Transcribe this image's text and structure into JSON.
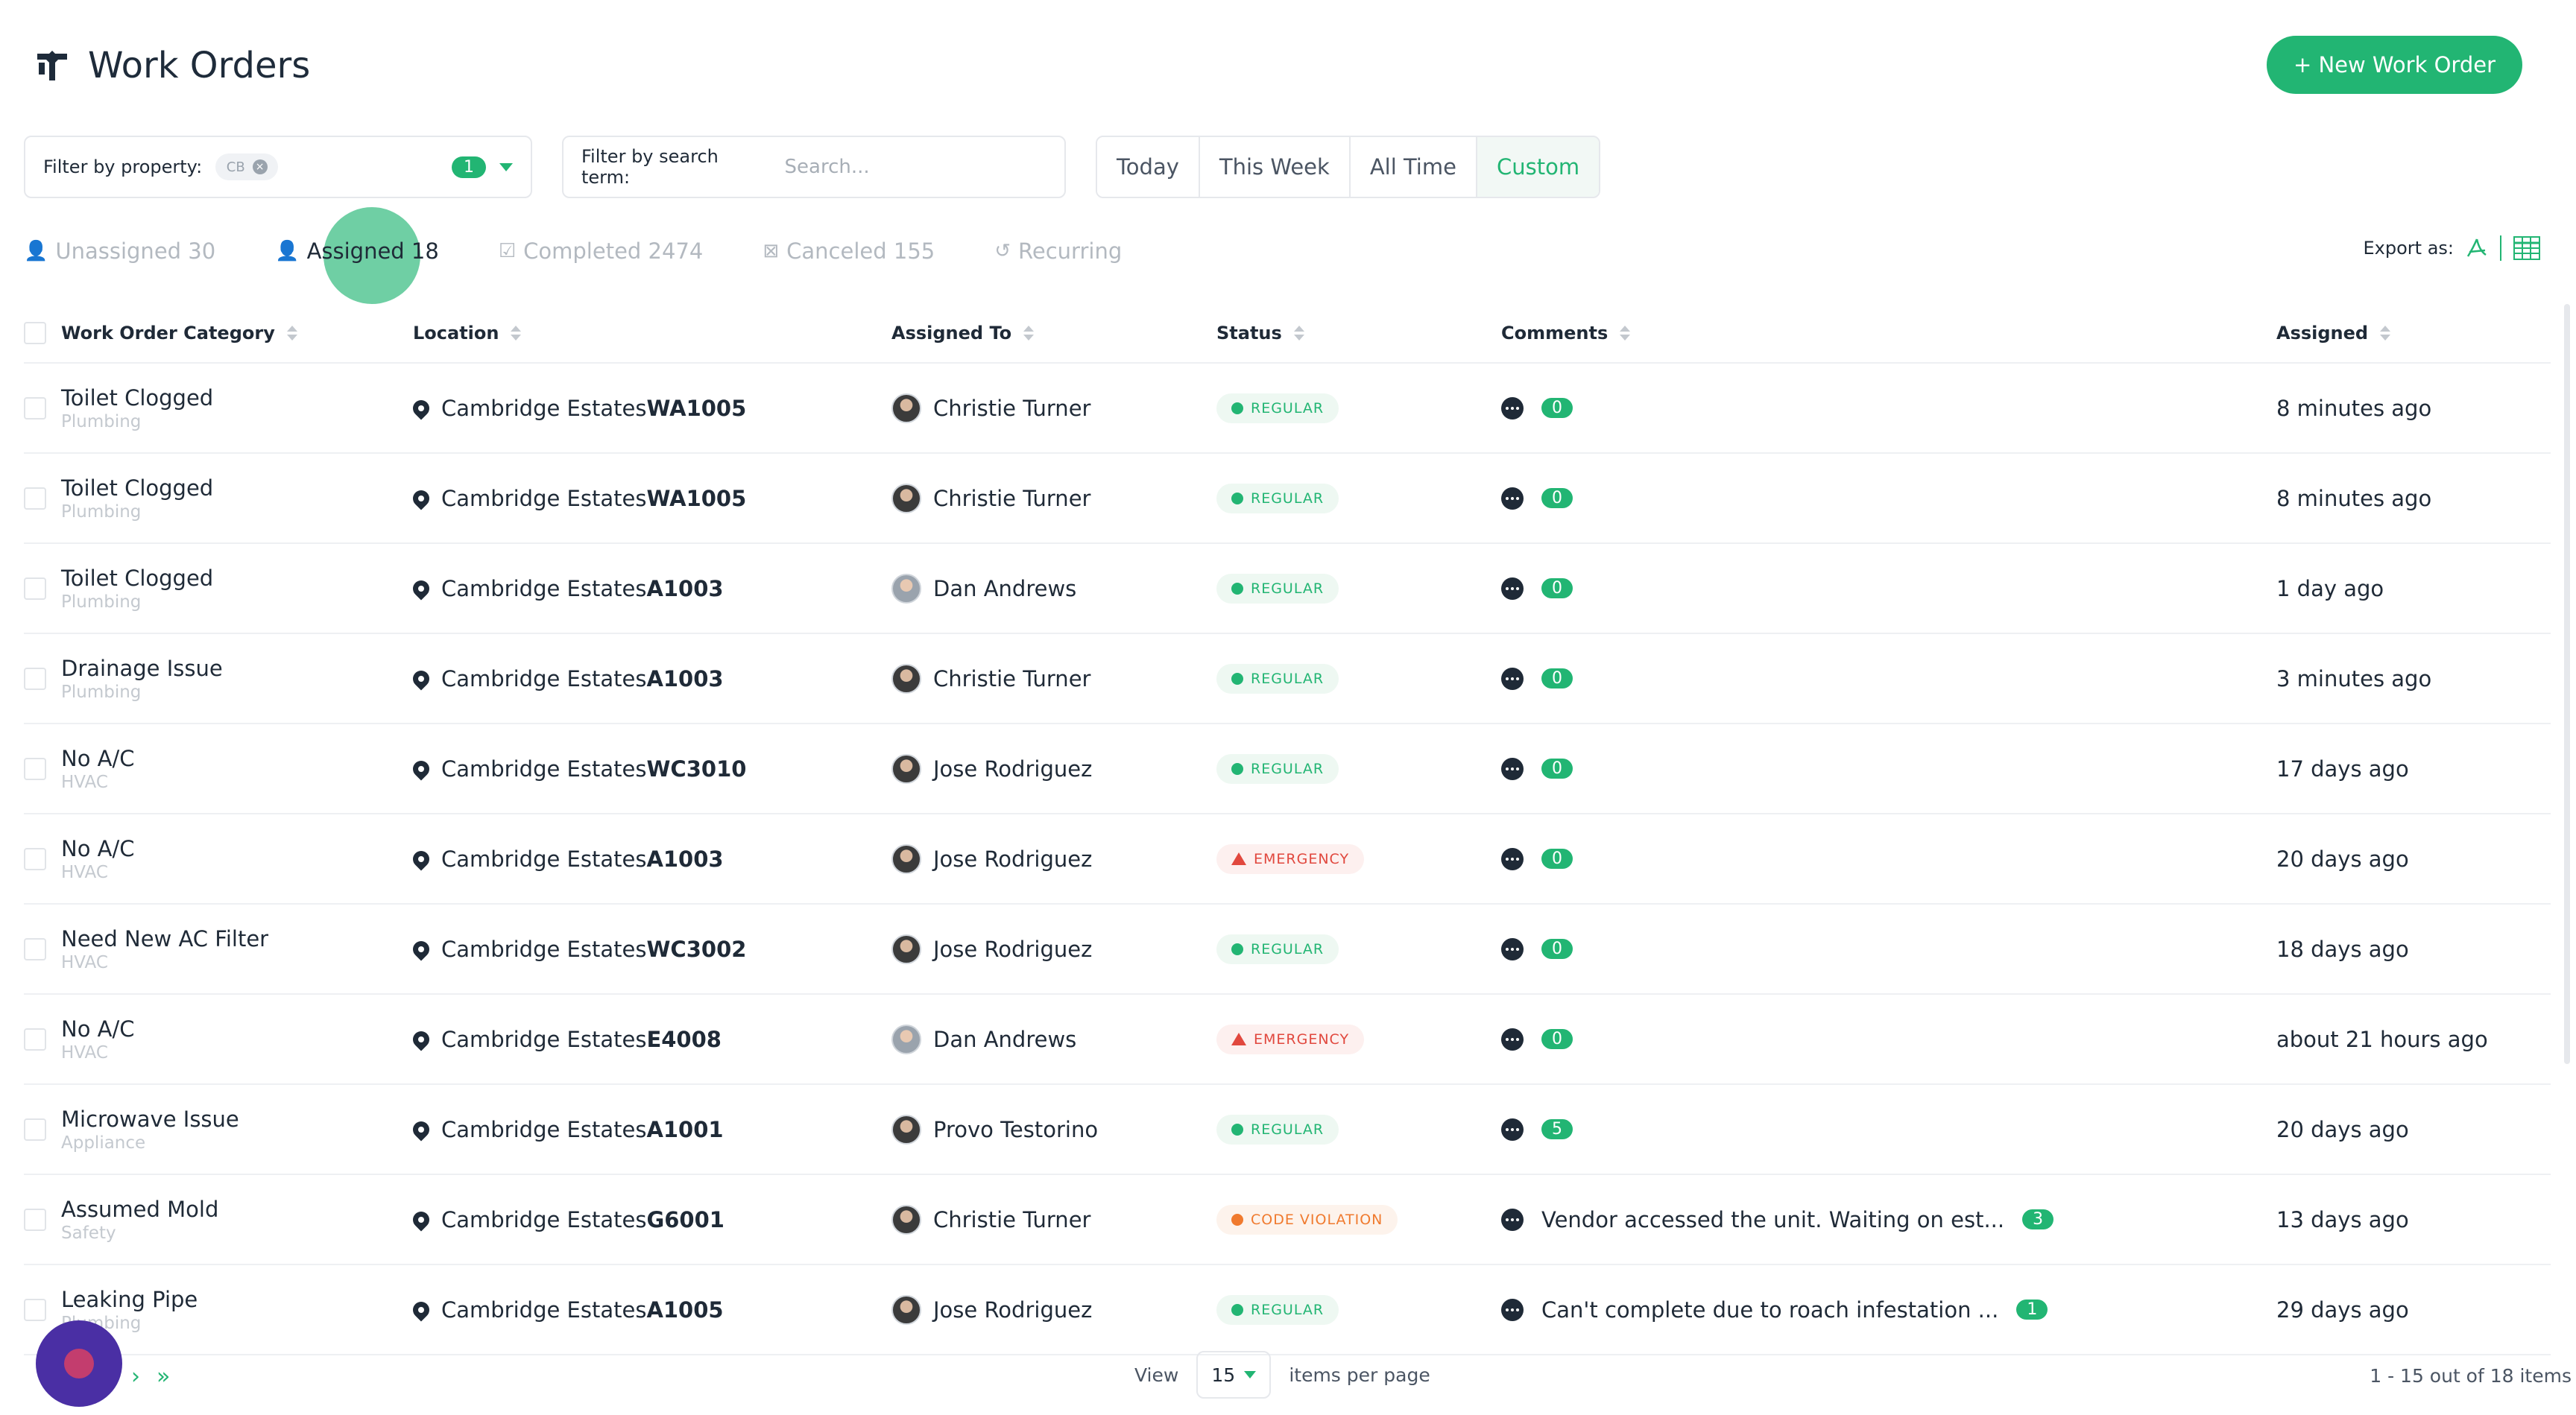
{
  "header": {
    "title": "Work Orders",
    "new_button": "+ New Work Order"
  },
  "filters": {
    "property_label": "Filter by property:",
    "property_chip": "CB",
    "property_count": "1",
    "search_label": "Filter by search term:",
    "search_placeholder": "Search...",
    "search_value": "",
    "time_ranges": [
      "Today",
      "This Week",
      "All Time",
      "Custom"
    ],
    "active_time_range": "Custom"
  },
  "tabs": [
    {
      "label": "Unassigned 30",
      "icon": "user-x-icon"
    },
    {
      "label": "Assigned 18",
      "icon": "user-icon"
    },
    {
      "label": "Completed 2474",
      "icon": "check-square-icon"
    },
    {
      "label": "Canceled 155",
      "icon": "x-square-icon"
    },
    {
      "label": "Recurring",
      "icon": "refresh-icon"
    }
  ],
  "active_tab": "Assigned 18",
  "export": {
    "label": "Export as:",
    "icons": [
      "pdf-icon",
      "spreadsheet-icon"
    ]
  },
  "columns": {
    "category": "Work Order Category",
    "location": "Location",
    "assigned_to": "Assigned To",
    "status": "Status",
    "comments": "Comments",
    "assigned": "Assigned"
  },
  "rows": [
    {
      "category": "Toilet Clogged",
      "subcategory": "Plumbing",
      "location": "Cambridge Estates",
      "unit": "WA1005",
      "assignee": "Christie Turner",
      "status": "REGULAR",
      "status_type": "regular",
      "comment": "",
      "comment_count": "0",
      "time": "8 minutes ago"
    },
    {
      "category": "Toilet Clogged",
      "subcategory": "Plumbing",
      "location": "Cambridge Estates",
      "unit": "WA1005",
      "assignee": "Christie Turner",
      "status": "REGULAR",
      "status_type": "regular",
      "comment": "",
      "comment_count": "0",
      "time": "8 minutes ago"
    },
    {
      "category": "Toilet Clogged",
      "subcategory": "Plumbing",
      "location": "Cambridge Estates",
      "unit": "A1003",
      "assignee": "Dan Andrews",
      "status": "REGULAR",
      "status_type": "regular",
      "comment": "",
      "comment_count": "0",
      "time": "1 day ago"
    },
    {
      "category": "Drainage Issue",
      "subcategory": "Plumbing",
      "location": "Cambridge Estates",
      "unit": "A1003",
      "assignee": "Christie Turner",
      "status": "REGULAR",
      "status_type": "regular",
      "comment": "",
      "comment_count": "0",
      "time": "3 minutes ago"
    },
    {
      "category": "No A/C",
      "subcategory": "HVAC",
      "location": "Cambridge Estates",
      "unit": "WC3010",
      "assignee": "Jose Rodriguez",
      "status": "REGULAR",
      "status_type": "regular",
      "comment": "",
      "comment_count": "0",
      "time": "17 days ago"
    },
    {
      "category": "No A/C",
      "subcategory": "HVAC",
      "location": "Cambridge Estates",
      "unit": "A1003",
      "assignee": "Jose Rodriguez",
      "status": "EMERGENCY",
      "status_type": "emergency",
      "comment": "",
      "comment_count": "0",
      "time": "20 days ago"
    },
    {
      "category": "Need New AC Filter",
      "subcategory": "HVAC",
      "location": "Cambridge Estates",
      "unit": "WC3002",
      "assignee": "Jose Rodriguez",
      "status": "REGULAR",
      "status_type": "regular",
      "comment": "",
      "comment_count": "0",
      "time": "18 days ago"
    },
    {
      "category": "No A/C",
      "subcategory": "HVAC",
      "location": "Cambridge Estates",
      "unit": "E4008",
      "assignee": "Dan Andrews",
      "status": "EMERGENCY",
      "status_type": "emergency",
      "comment": "",
      "comment_count": "0",
      "time": "about 21 hours ago"
    },
    {
      "category": "Microwave Issue",
      "subcategory": "Appliance",
      "location": "Cambridge Estates",
      "unit": "A1001",
      "assignee": "Provo Testorino",
      "status": "REGULAR",
      "status_type": "regular",
      "comment": "",
      "comment_count": "5",
      "time": "20 days ago"
    },
    {
      "category": "Assumed Mold",
      "subcategory": "Safety",
      "location": "Cambridge Estates",
      "unit": "G6001",
      "assignee": "Christie Turner",
      "status": "CODE VIOLATION",
      "status_type": "code",
      "comment": "Vendor accessed the unit. Waiting on est...",
      "comment_count": "3",
      "time": "13 days ago"
    },
    {
      "category": "Leaking Pipe",
      "subcategory": "Plumbing",
      "location": "Cambridge Estates",
      "unit": "A1005",
      "assignee": "Jose Rodriguez",
      "status": "REGULAR",
      "status_type": "regular",
      "comment": "Can't complete due to roach infestation ...",
      "comment_count": "1",
      "time": "29 days ago"
    }
  ],
  "pagination": {
    "view_label": "View",
    "per_page": "15",
    "per_page_label": "items per page",
    "range": "1 - 15 out of 18 items",
    "next": "›",
    "last": "»"
  },
  "colors": {
    "accent": "#22b573",
    "emergency": "#e1483e",
    "code_violation": "#f07a2e",
    "fab": "#4a2fa4"
  }
}
